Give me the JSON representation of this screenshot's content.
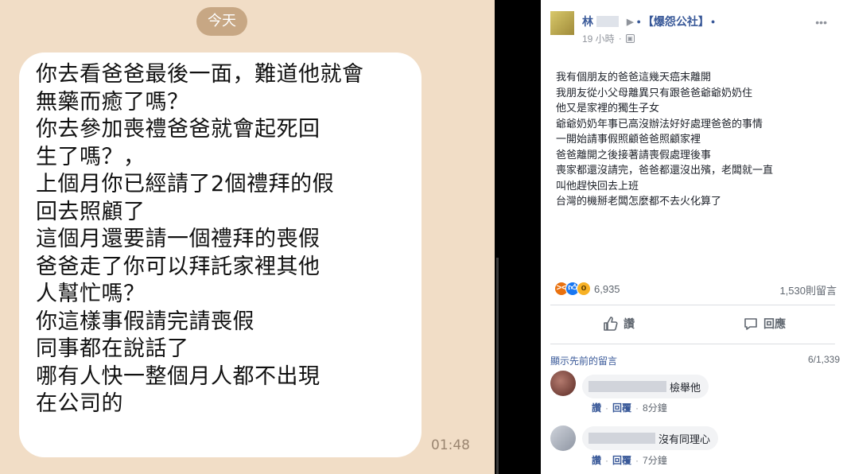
{
  "chat": {
    "date_label": "今天",
    "message_lines": [
      "你去看爸爸最後一面，難道他就會",
      "無藥而癒了嗎？",
      "你去參加喪禮爸爸就會起死回",
      "生了嗎？，",
      "上個月你已經請了2個禮拜的假",
      "回去照顧了",
      "這個月還要請一個禮拜的喪假",
      "爸爸走了你可以拜託家裡其他",
      "人幫忙嗎？",
      "你這樣事假請完請喪假",
      "同事都在說話了",
      "哪有人快一整個月人都不出現",
      "在公司的"
    ],
    "time": "01:48"
  },
  "post": {
    "author_prefix": "林",
    "group_name": "【爆怨公社】",
    "time_ago": "19 小時",
    "meta_separator": "·",
    "body_lines": [
      "我有個朋友的爸爸這幾天癌末離開",
      "我朋友從小父母離異只有跟爸爸爺爺奶奶住",
      "他又是家裡的獨生子女",
      "爺爺奶奶年事已高沒辦法好好處理爸爸的事情",
      "一開始請事假照顧爸爸照顧家裡",
      "爸爸離開之後接著請喪假處理後事",
      "喪家都還沒請完，爸爸都還沒出殯，老闆就一直",
      "叫他趕快回去上班",
      "台灣的機掰老闆怎麼都不去火化算了"
    ],
    "reaction_count": "6,935",
    "comment_count": "1,530則留言",
    "like_label": "讚",
    "comment_label": "回應",
    "prev_comments_label": "顯示先前的留言",
    "prev_comments_count": "6/1,339",
    "comments": [
      {
        "text": "檢舉他",
        "like": "讚",
        "reply": "回覆",
        "time": "8分鐘"
      },
      {
        "text": "沒有同理心",
        "like": "讚",
        "reply": "回覆",
        "time": "7分鐘"
      }
    ]
  },
  "colors": {
    "chat_background": "#f1ddc6",
    "date_pill": "#c7a784",
    "facebook_link": "#385898",
    "angry_reaction": "#e9710f",
    "like_reaction": "#1877f2",
    "wow_reaction": "#f7b125"
  },
  "icons": [
    "like-thumb-icon",
    "comment-speech-icon",
    "globe-icon",
    "angry-reaction-icon",
    "like-reaction-icon",
    "wow-reaction-icon"
  ]
}
